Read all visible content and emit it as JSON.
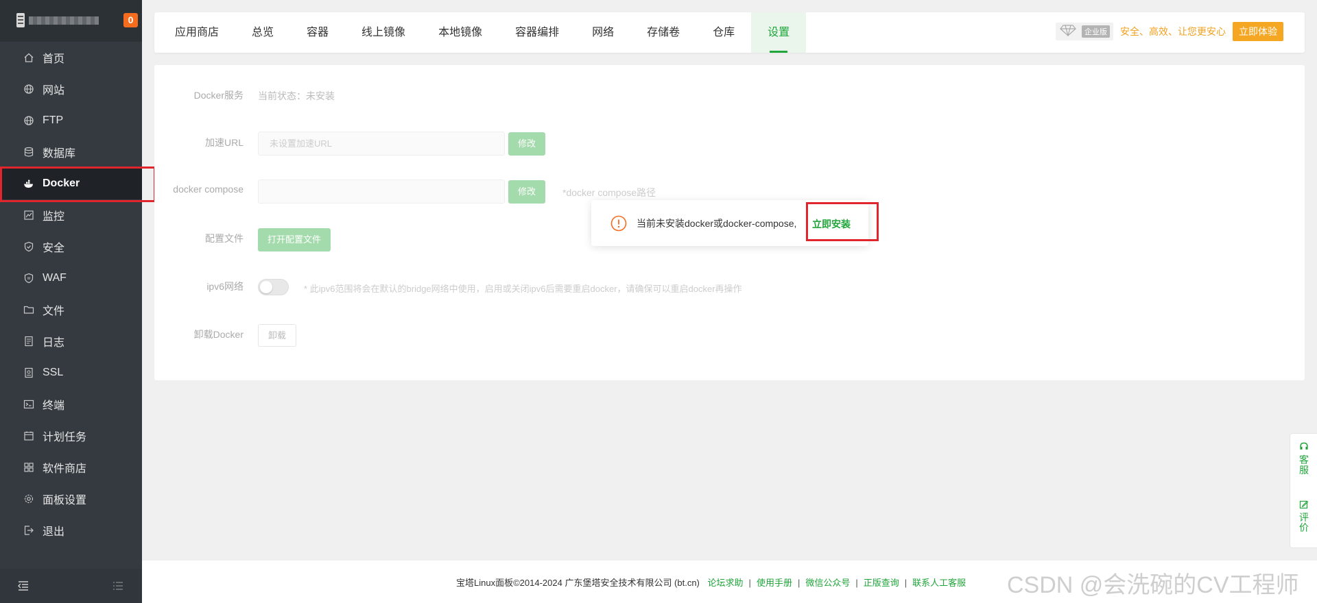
{
  "sidebar": {
    "badge": "0",
    "items": [
      {
        "label": "首页",
        "icon": "home-icon"
      },
      {
        "label": "网站",
        "icon": "globe-icon"
      },
      {
        "label": "FTP",
        "icon": "globe-icon"
      },
      {
        "label": "数据库",
        "icon": "database-icon"
      },
      {
        "label": "Docker",
        "icon": "docker-icon",
        "active": true
      },
      {
        "label": "监控",
        "icon": "monitor-icon"
      },
      {
        "label": "安全",
        "icon": "shield-icon"
      },
      {
        "label": "WAF",
        "icon": "waf-shield-icon"
      },
      {
        "label": "文件",
        "icon": "folder-icon"
      },
      {
        "label": "日志",
        "icon": "log-icon"
      },
      {
        "label": "SSL",
        "icon": "certificate-icon"
      },
      {
        "label": "终端",
        "icon": "terminal-icon"
      },
      {
        "label": "计划任务",
        "icon": "calendar-icon"
      },
      {
        "label": "软件商店",
        "icon": "grid-icon"
      },
      {
        "label": "面板设置",
        "icon": "gear-icon"
      },
      {
        "label": "退出",
        "icon": "logout-icon"
      }
    ]
  },
  "tabs": [
    "应用商店",
    "总览",
    "容器",
    "线上镜像",
    "本地镜像",
    "容器编排",
    "网络",
    "存储卷",
    "仓库",
    "设置"
  ],
  "active_tab": "设置",
  "promo": {
    "enterprise_label": "企业版",
    "text": "安全、高效、让您更安心",
    "try_button": "立即体验"
  },
  "settings": {
    "docker_service_label": "Docker服务",
    "docker_service_status": "当前状态：未安装",
    "mirror_url_label": "加速URL",
    "mirror_url_placeholder": "未设置加速URL",
    "mirror_modify": "修改",
    "compose_label": "docker compose",
    "compose_value": "",
    "compose_modify": "修改",
    "compose_hint": "*docker compose路径",
    "config_file_label": "配置文件",
    "config_file_button": "打开配置文件",
    "ipv6_label": "ipv6网络",
    "ipv6_enabled": false,
    "ipv6_hint": "* 此ipv6范围将会在默认的bridge网络中使用，启用或关闭ipv6后需要重启docker，请确保可以重启docker再操作",
    "uninstall_label": "卸载Docker",
    "uninstall_button": "卸载"
  },
  "popup": {
    "message": "当前未安装docker或docker-compose,",
    "action": "立即安装"
  },
  "footer": {
    "copyright": "宝塔Linux面板©2014-2024 广东堡塔安全技术有限公司 (bt.cn)",
    "links": [
      "论坛求助",
      "使用手册",
      "微信公众号",
      "正版查询",
      "联系人工客服"
    ]
  },
  "float": {
    "support": "客服",
    "feedback": "评价"
  },
  "watermark": "CSDN @会洗碗的CV工程师",
  "colors": {
    "brand_green": "#20a53a",
    "sidebar_bg": "#343a40",
    "highlight_red": "#e0262c",
    "promo_orange": "#f5a623"
  }
}
